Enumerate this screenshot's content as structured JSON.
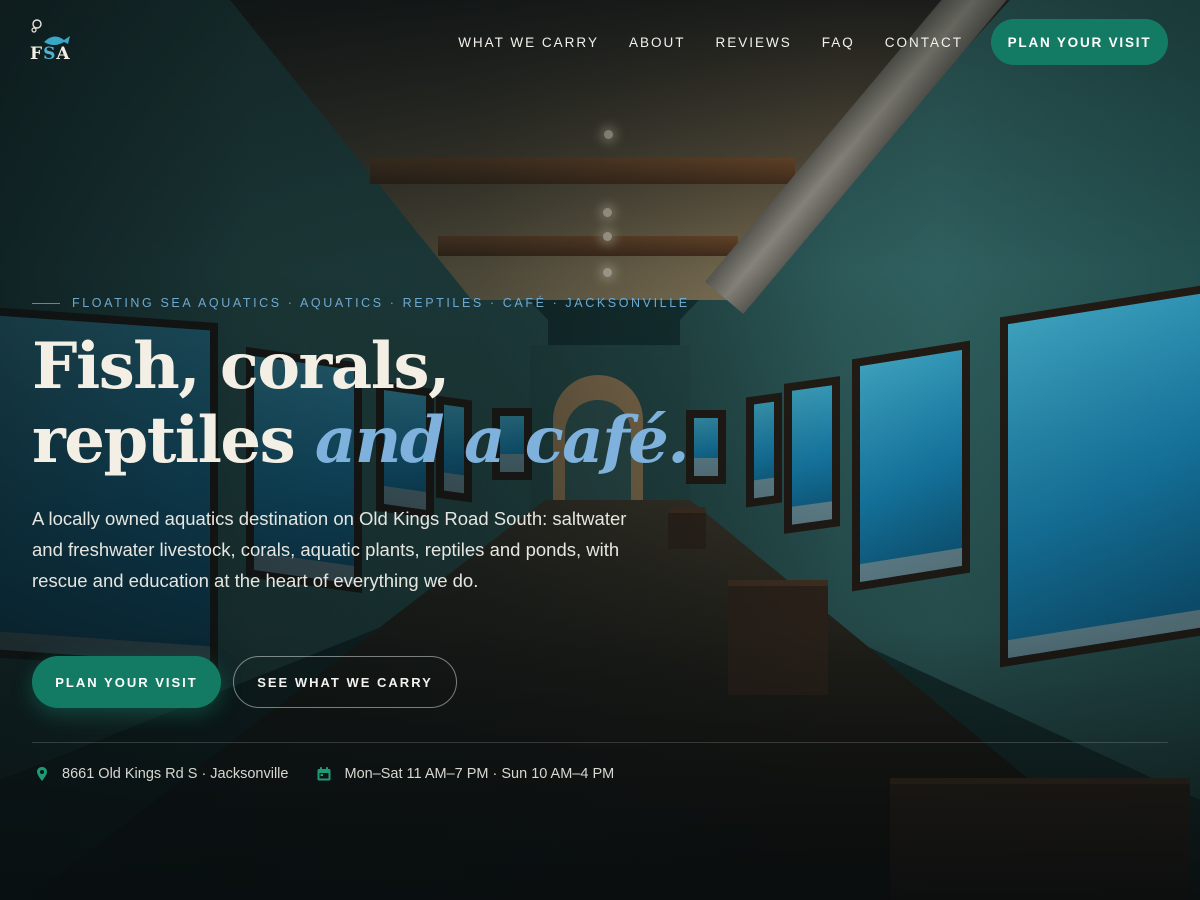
{
  "brand": {
    "logo_letters_start": "F",
    "logo_letters_mid": "S",
    "logo_letters_end": "A"
  },
  "nav": {
    "items": [
      {
        "label": "WHAT WE CARRY"
      },
      {
        "label": "ABOUT"
      },
      {
        "label": "REVIEWS"
      },
      {
        "label": "FAQ"
      },
      {
        "label": "CONTACT"
      }
    ],
    "cta_label": "PLAN YOUR VISIT"
  },
  "hero": {
    "eyebrow": "FLOATING SEA AQUATICS · AQUATICS · REPTILES · CAFÉ · JACKSONVILLE",
    "headline_line1": "Fish, corals,",
    "headline_line2_plain": "reptiles",
    "headline_line2_italic": "and a café.",
    "lede": "A locally owned aquatics destination on Old Kings Road South: saltwater and freshwater livestock, corals, aquatic plants, reptiles and ponds, with rescue and education at the heart of everything we do.",
    "primary_button": "PLAN YOUR VISIT",
    "secondary_button": "SEE WHAT WE CARRY"
  },
  "info": {
    "address": "8661 Old Kings Rd S · Jacksonville",
    "hours": "Mon–Sat 11 AM–7 PM · Sun 10 AM–4 PM"
  },
  "icons": {
    "address": "map-pin-icon",
    "hours": "calendar-icon"
  },
  "colors": {
    "accent_green": "#137b63",
    "accent_blue": "#7eb2dc",
    "eyebrow_blue": "#6ea8cf",
    "headline": "#f3efe4"
  }
}
